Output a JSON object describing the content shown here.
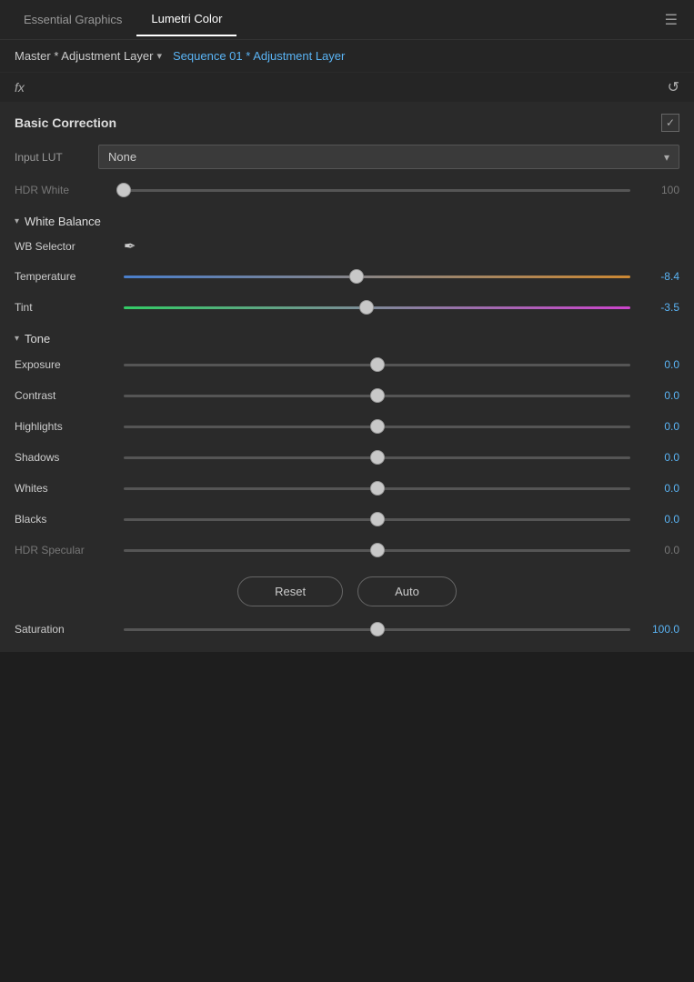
{
  "tabs": {
    "essential_graphics": "Essential Graphics",
    "lumetri_color": "Lumetri Color",
    "menu_icon": "☰"
  },
  "header": {
    "layer_name": "Master * Adjustment Layer",
    "chevron": "▾",
    "seq_label": "Sequence 01 * Adjustment Layer"
  },
  "fx": {
    "label": "fx",
    "reset_icon": "↺"
  },
  "basic_correction": {
    "title": "Basic Correction",
    "checkbox_icon": "✓",
    "input_lut": {
      "label": "Input LUT",
      "value": "None",
      "chevron": "▾"
    },
    "hdr_white": {
      "label": "HDR White",
      "value": "100",
      "thumb_pos": "0%"
    }
  },
  "white_balance": {
    "section_title": "White Balance",
    "chevron": "▾",
    "wb_selector": {
      "label": "WB Selector",
      "icon": "✏"
    },
    "temperature": {
      "label": "Temperature",
      "value": "-8.4",
      "thumb_pos": "46%"
    },
    "tint": {
      "label": "Tint",
      "value": "-3.5",
      "thumb_pos": "48%"
    }
  },
  "tone": {
    "section_title": "Tone",
    "chevron": "▾",
    "exposure": {
      "label": "Exposure",
      "value": "0.0",
      "thumb_pos": "50%"
    },
    "contrast": {
      "label": "Contrast",
      "value": "0.0",
      "thumb_pos": "50%"
    },
    "highlights": {
      "label": "Highlights",
      "value": "0.0",
      "thumb_pos": "50%"
    },
    "shadows": {
      "label": "Shadows",
      "value": "0.0",
      "thumb_pos": "50%"
    },
    "whites": {
      "label": "Whites",
      "value": "0.0",
      "thumb_pos": "50%"
    },
    "blacks": {
      "label": "Blacks",
      "value": "0.0",
      "thumb_pos": "50%"
    },
    "hdr_specular": {
      "label": "HDR Specular",
      "value": "0.0",
      "thumb_pos": "50%"
    }
  },
  "buttons": {
    "reset": "Reset",
    "auto": "Auto"
  },
  "saturation": {
    "label": "Saturation",
    "value": "100.0",
    "thumb_pos": "50%"
  }
}
